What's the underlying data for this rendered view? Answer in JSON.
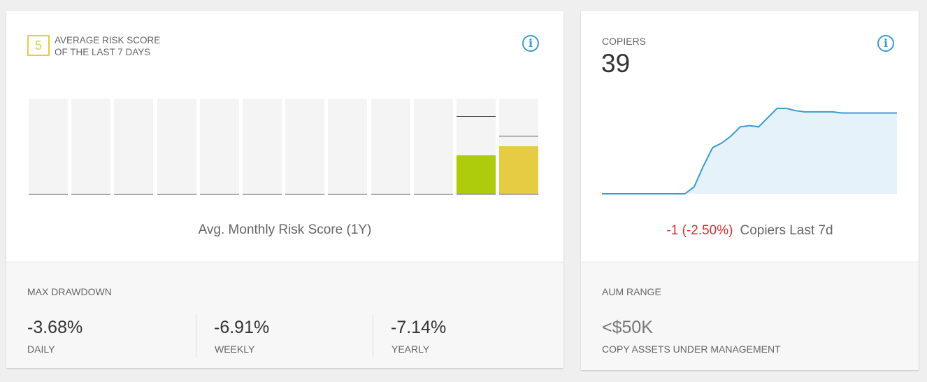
{
  "risk_card": {
    "score": "5",
    "title": "AVERAGE RISK SCORE\nOF THE LAST 7 DAYS",
    "info_glyph": "i",
    "caption": "Avg. Monthly Risk Score (1Y)",
    "bars": [
      {
        "value": 0,
        "avg": 0,
        "color": ""
      },
      {
        "value": 0,
        "avg": 0,
        "color": ""
      },
      {
        "value": 0,
        "avg": 0,
        "color": ""
      },
      {
        "value": 0,
        "avg": 0,
        "color": ""
      },
      {
        "value": 0,
        "avg": 0,
        "color": ""
      },
      {
        "value": 0,
        "avg": 0,
        "color": ""
      },
      {
        "value": 0,
        "avg": 0,
        "color": ""
      },
      {
        "value": 0,
        "avg": 0,
        "color": ""
      },
      {
        "value": 0,
        "avg": 0,
        "color": ""
      },
      {
        "value": 0,
        "avg": 0,
        "color": ""
      },
      {
        "value": 0.4,
        "avg": 0.8,
        "color": "#aecc0b"
      },
      {
        "value": 0.5,
        "avg": 0.6,
        "color": "#e6cc43"
      }
    ],
    "max_drawdown": {
      "label": "MAX DRAWDOWN",
      "daily": {
        "value": "-3.68%",
        "label": "DAILY"
      },
      "weekly": {
        "value": "-6.91%",
        "label": "WEEKLY"
      },
      "yearly": {
        "value": "-7.14%",
        "label": "YEARLY"
      }
    }
  },
  "copiers_card": {
    "label": "COPIERS",
    "count": "39",
    "info_glyph": "i",
    "change": "-1 (-2.50%)",
    "change_label": "Copiers Last 7d",
    "line_color": "#3a9bd0",
    "area_color": "#e6f2fa",
    "series": [
      0,
      0,
      0,
      0,
      0,
      0,
      0,
      0,
      0,
      0,
      3,
      12,
      20,
      22,
      25,
      29,
      29.5,
      29,
      33,
      37,
      37,
      36,
      35.5,
      35.5,
      35.5,
      35.5,
      35,
      35,
      35,
      35,
      35,
      35,
      35
    ],
    "aum_label": "AUM RANGE",
    "aum_value": "<$50K",
    "aum_sub": "COPY ASSETS UNDER MANAGEMENT"
  }
}
